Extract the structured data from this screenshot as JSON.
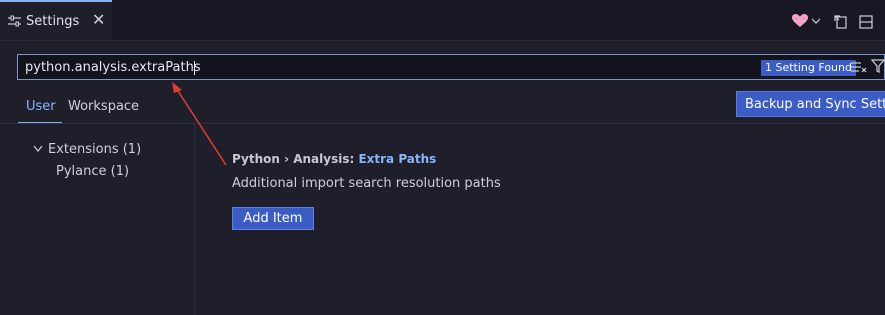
{
  "tab": {
    "label": "Settings",
    "close": "✕",
    "icon": "settings-sliders-icon"
  },
  "actions": {
    "heart_color": "#f5a3c7",
    "icons": [
      "heart-icon",
      "chevron-down-icon",
      "open-settings-json-icon",
      "split-layout-icon"
    ]
  },
  "search": {
    "value": "python.analysis.extraPaths",
    "results_badge": "1 Setting Found",
    "icons": [
      "clear-filter-icon",
      "filter-icon"
    ]
  },
  "scopes": {
    "user": "User",
    "workspace": "Workspace"
  },
  "backup_button": "Backup and Sync Settings",
  "tree": {
    "extensions": "Extensions (1)",
    "pylance": "Pylance (1)"
  },
  "setting": {
    "category": "Python › Analysis: ",
    "name": "Extra Paths",
    "description": "Additional import search resolution paths",
    "add_button": "Add Item"
  },
  "colors": {
    "accent": "#89b4fa",
    "button": "#3b5cc4",
    "background": "#1f1f2c",
    "annotation_arrow": "#e03c31"
  }
}
